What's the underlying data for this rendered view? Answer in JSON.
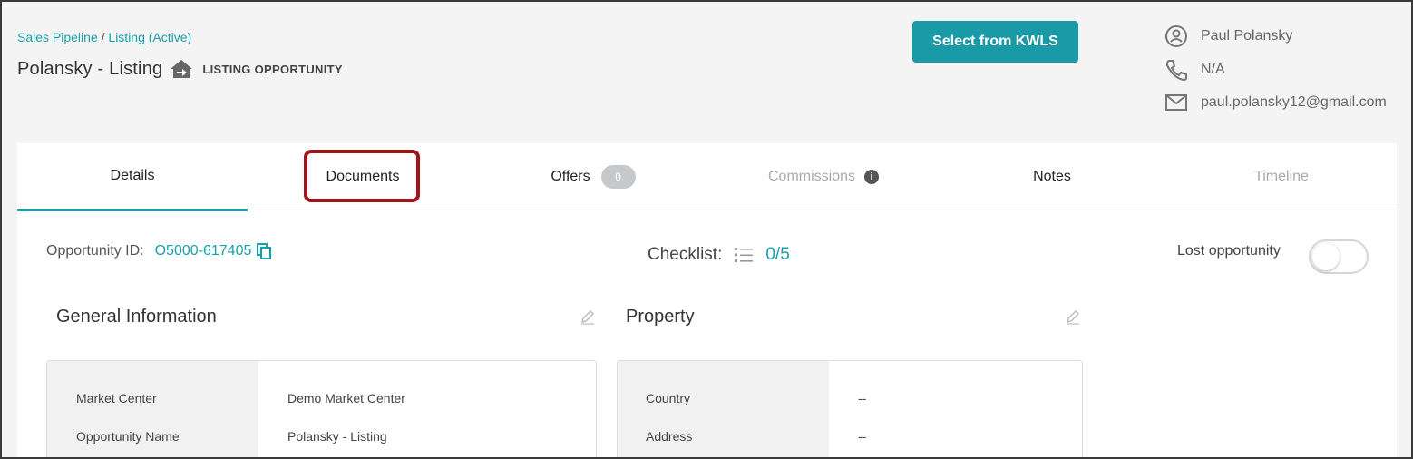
{
  "breadcrumb": {
    "root": "Sales Pipeline",
    "separator": " / ",
    "current": "Listing (Active)"
  },
  "header": {
    "title": "Polansky - Listing",
    "type_label": "LISTING OPPORTUNITY",
    "kwls_button": "Select from KWLS"
  },
  "contact": {
    "name": "Paul Polansky",
    "phone": "N/A",
    "email": "paul.polansky12@gmail.com"
  },
  "tabs": [
    {
      "label": "Details"
    },
    {
      "label": "Documents"
    },
    {
      "label": "Offers",
      "badge": "0"
    },
    {
      "label": "Commissions",
      "info": "i"
    },
    {
      "label": "Notes"
    },
    {
      "label": "Timeline"
    }
  ],
  "opportunity": {
    "id_label": "Opportunity ID:",
    "id_value": "O5000-617405"
  },
  "checklist": {
    "label": "Checklist:",
    "count": "0/5"
  },
  "lost_opportunity": {
    "label": "Lost opportunity",
    "enabled": false
  },
  "general_info": {
    "title": "General Information",
    "rows": [
      {
        "label": "Market Center",
        "value": "Demo Market Center"
      },
      {
        "label": "Opportunity Name",
        "value": "Polansky - Listing"
      }
    ]
  },
  "property": {
    "title": "Property",
    "rows": [
      {
        "label": "Country",
        "value": "--"
      },
      {
        "label": "Address",
        "value": "--"
      }
    ]
  },
  "colors": {
    "accent": "#19a0ad",
    "highlight": "#a3131a"
  }
}
